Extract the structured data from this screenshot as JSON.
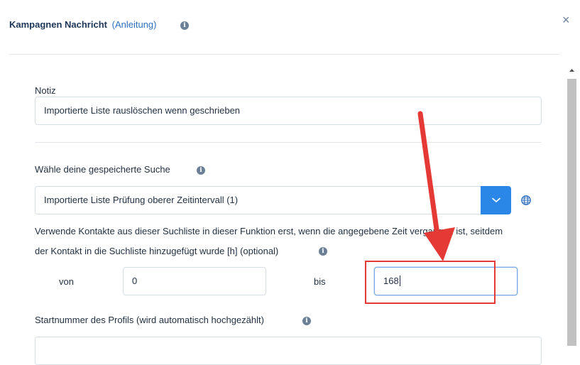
{
  "header": {
    "title": "Kampagnen Nachricht",
    "guide_link": "(Anleitung)",
    "info_icon": "info-icon",
    "close_icon": "close-icon",
    "close_glyph": "×"
  },
  "notes": {
    "label": "Notiz",
    "value": "Importierte Liste rauslöschen wenn geschrieben"
  },
  "saved_search": {
    "label": "Wähle deine gespeicherte Suche",
    "selected": "Importierte Liste Prüfung oberer Zeitintervall (1)",
    "dropdown_icon": "chevron-down-icon",
    "globe_icon": "globe-icon"
  },
  "time_window": {
    "description_line1": "Verwende Kontakte aus dieser Suchliste in dieser Funktion erst, wenn die angegebene Zeit vergangen ist, seitdem",
    "description_line2": "der Kontakt in die Suchliste hinzugefügt wurde [h] (optional)",
    "from_label": "von",
    "from_value": "0",
    "to_label": "bis",
    "to_value": "168"
  },
  "profile_start": {
    "label": "Startnummer des Profils (wird automatisch hochgezählt)",
    "value": ""
  },
  "annotation": {
    "arrow_color": "#e53935",
    "highlight_color": "#e53935"
  },
  "colors": {
    "primary": "#2a87e8",
    "title": "#1d3557",
    "link": "#2f6fbf",
    "icon_gray": "#6b7f96"
  }
}
